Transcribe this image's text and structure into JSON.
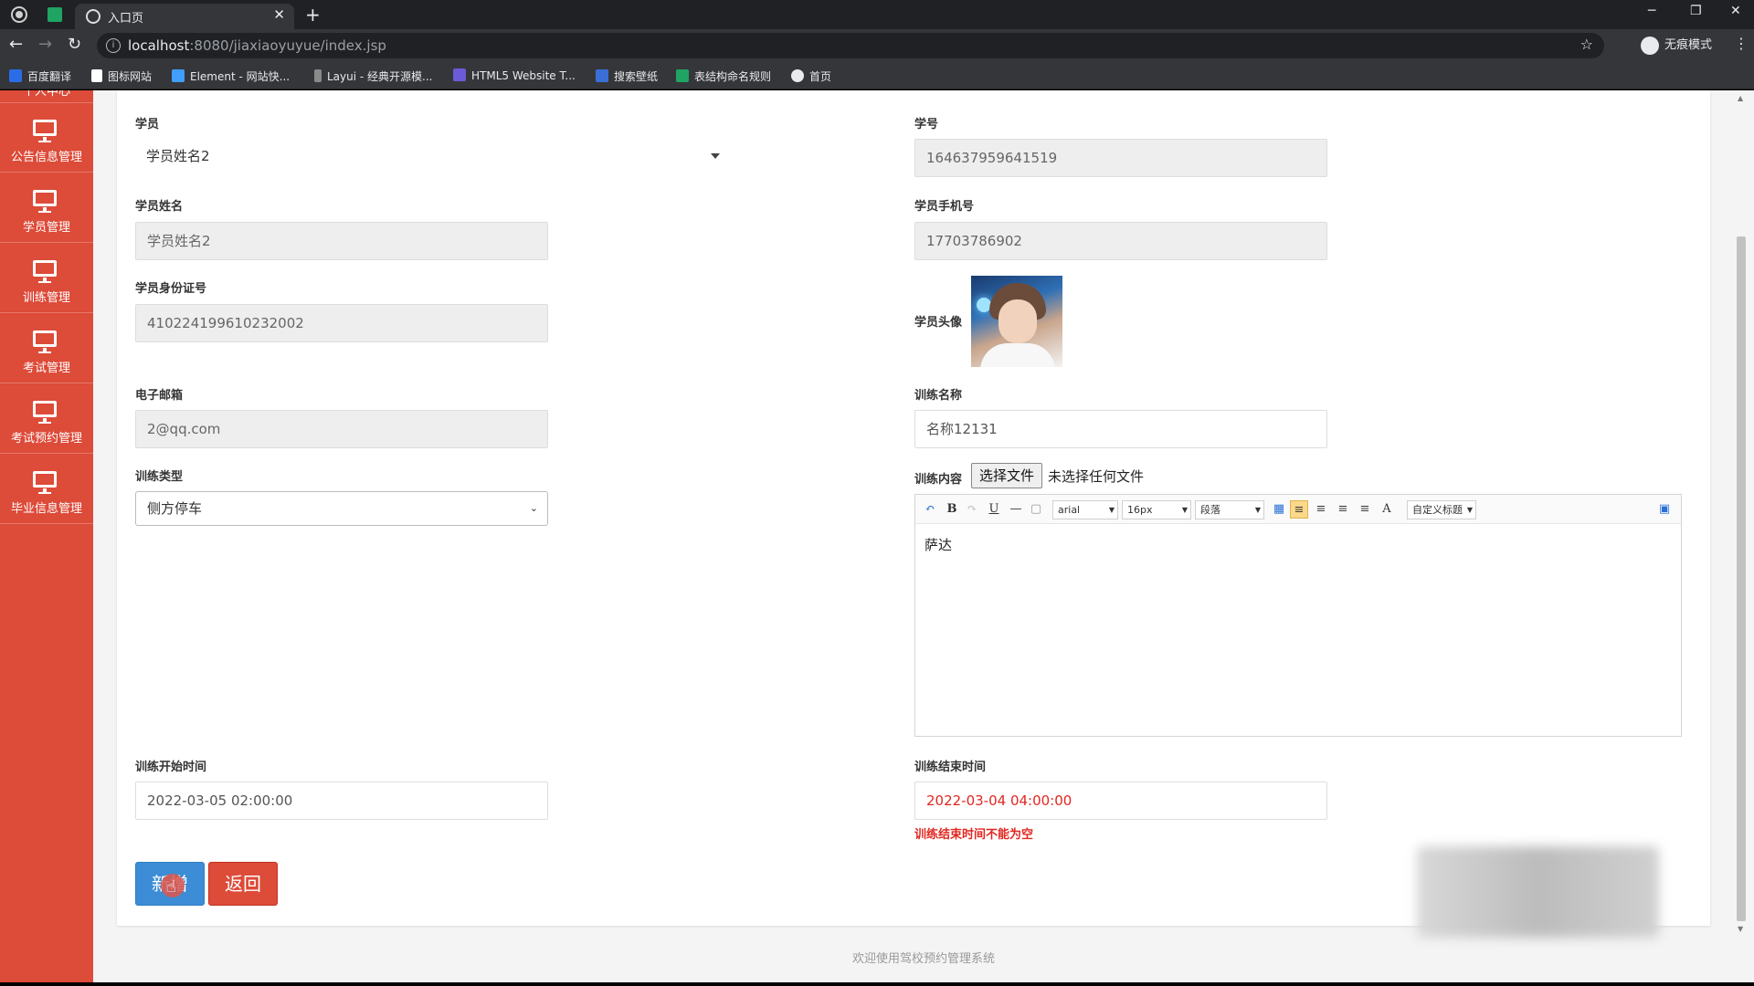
{
  "browser": {
    "tab_title": "入口页",
    "url_host": "localhost",
    "url_path": ":8080/jiaxiaoyuyue/index.jsp",
    "incognito_label": "无痕模式",
    "bookmarks": [
      {
        "label": "百度翻译",
        "color": "#2b6de6"
      },
      {
        "label": "图标网站",
        "color": "#ffffff"
      },
      {
        "label": "Element - 网站快...",
        "color": "#409eff"
      },
      {
        "label": "Layui - 经典开源模...",
        "color": "#8a8a8a"
      },
      {
        "label": "HTML5 Website T...",
        "color": "#6b5bd6"
      },
      {
        "label": "搜索壁纸",
        "color": "#3b6fd8"
      },
      {
        "label": "表结构命名规则",
        "color": "#1fa463"
      },
      {
        "label": "首页",
        "color": "#e8eaed"
      }
    ]
  },
  "sidebar": {
    "top_label": "个人中心",
    "items": [
      {
        "label": "公告信息管理",
        "icon": "monitor-icon"
      },
      {
        "label": "学员管理",
        "icon": "monitor-icon"
      },
      {
        "label": "训练管理",
        "icon": "monitor-icon"
      },
      {
        "label": "考试管理",
        "icon": "monitor-icon"
      },
      {
        "label": "考试预约管理",
        "icon": "monitor-icon"
      },
      {
        "label": "毕业信息管理",
        "icon": "monitor-icon"
      }
    ],
    "color": "#dd4b39"
  },
  "form": {
    "student": {
      "label": "学员",
      "value": "学员姓名2"
    },
    "student_no": {
      "label": "学号",
      "value": "164637959641519"
    },
    "student_name": {
      "label": "学员姓名",
      "value": "学员姓名2"
    },
    "student_phone": {
      "label": "学员手机号",
      "value": "17703786902"
    },
    "student_id": {
      "label": "学员身份证号",
      "value": "410224199610232002"
    },
    "student_avatar": {
      "label": "学员头像"
    },
    "email": {
      "label": "电子邮箱",
      "value": "2@qq.com"
    },
    "training_name": {
      "label": "训练名称",
      "value": "名称12131"
    },
    "training_type": {
      "label": "训练类型",
      "value": "侧方停车"
    },
    "training_content": {
      "label": "训练内容",
      "file_button": "选择文件",
      "file_status": "未选择任何文件",
      "editor_font": "arial",
      "editor_size": "16px",
      "editor_paragraph": "段落",
      "editor_custom_title": "自定义标题",
      "editor_text": "萨达"
    },
    "start_time": {
      "label": "训练开始时间",
      "value": "2022-03-05 02:00:00"
    },
    "end_time": {
      "label": "训练结束时间",
      "value": "2022-03-04 04:00:00",
      "error": "训练结束时间不能为空"
    },
    "submit_label": "新增",
    "back_label": "返回"
  },
  "footer": {
    "text": "欢迎使用驾校预约管理系统"
  },
  "colors": {
    "primary": "#3c8dd6",
    "danger": "#dd4b39",
    "error": "#e2261f"
  }
}
